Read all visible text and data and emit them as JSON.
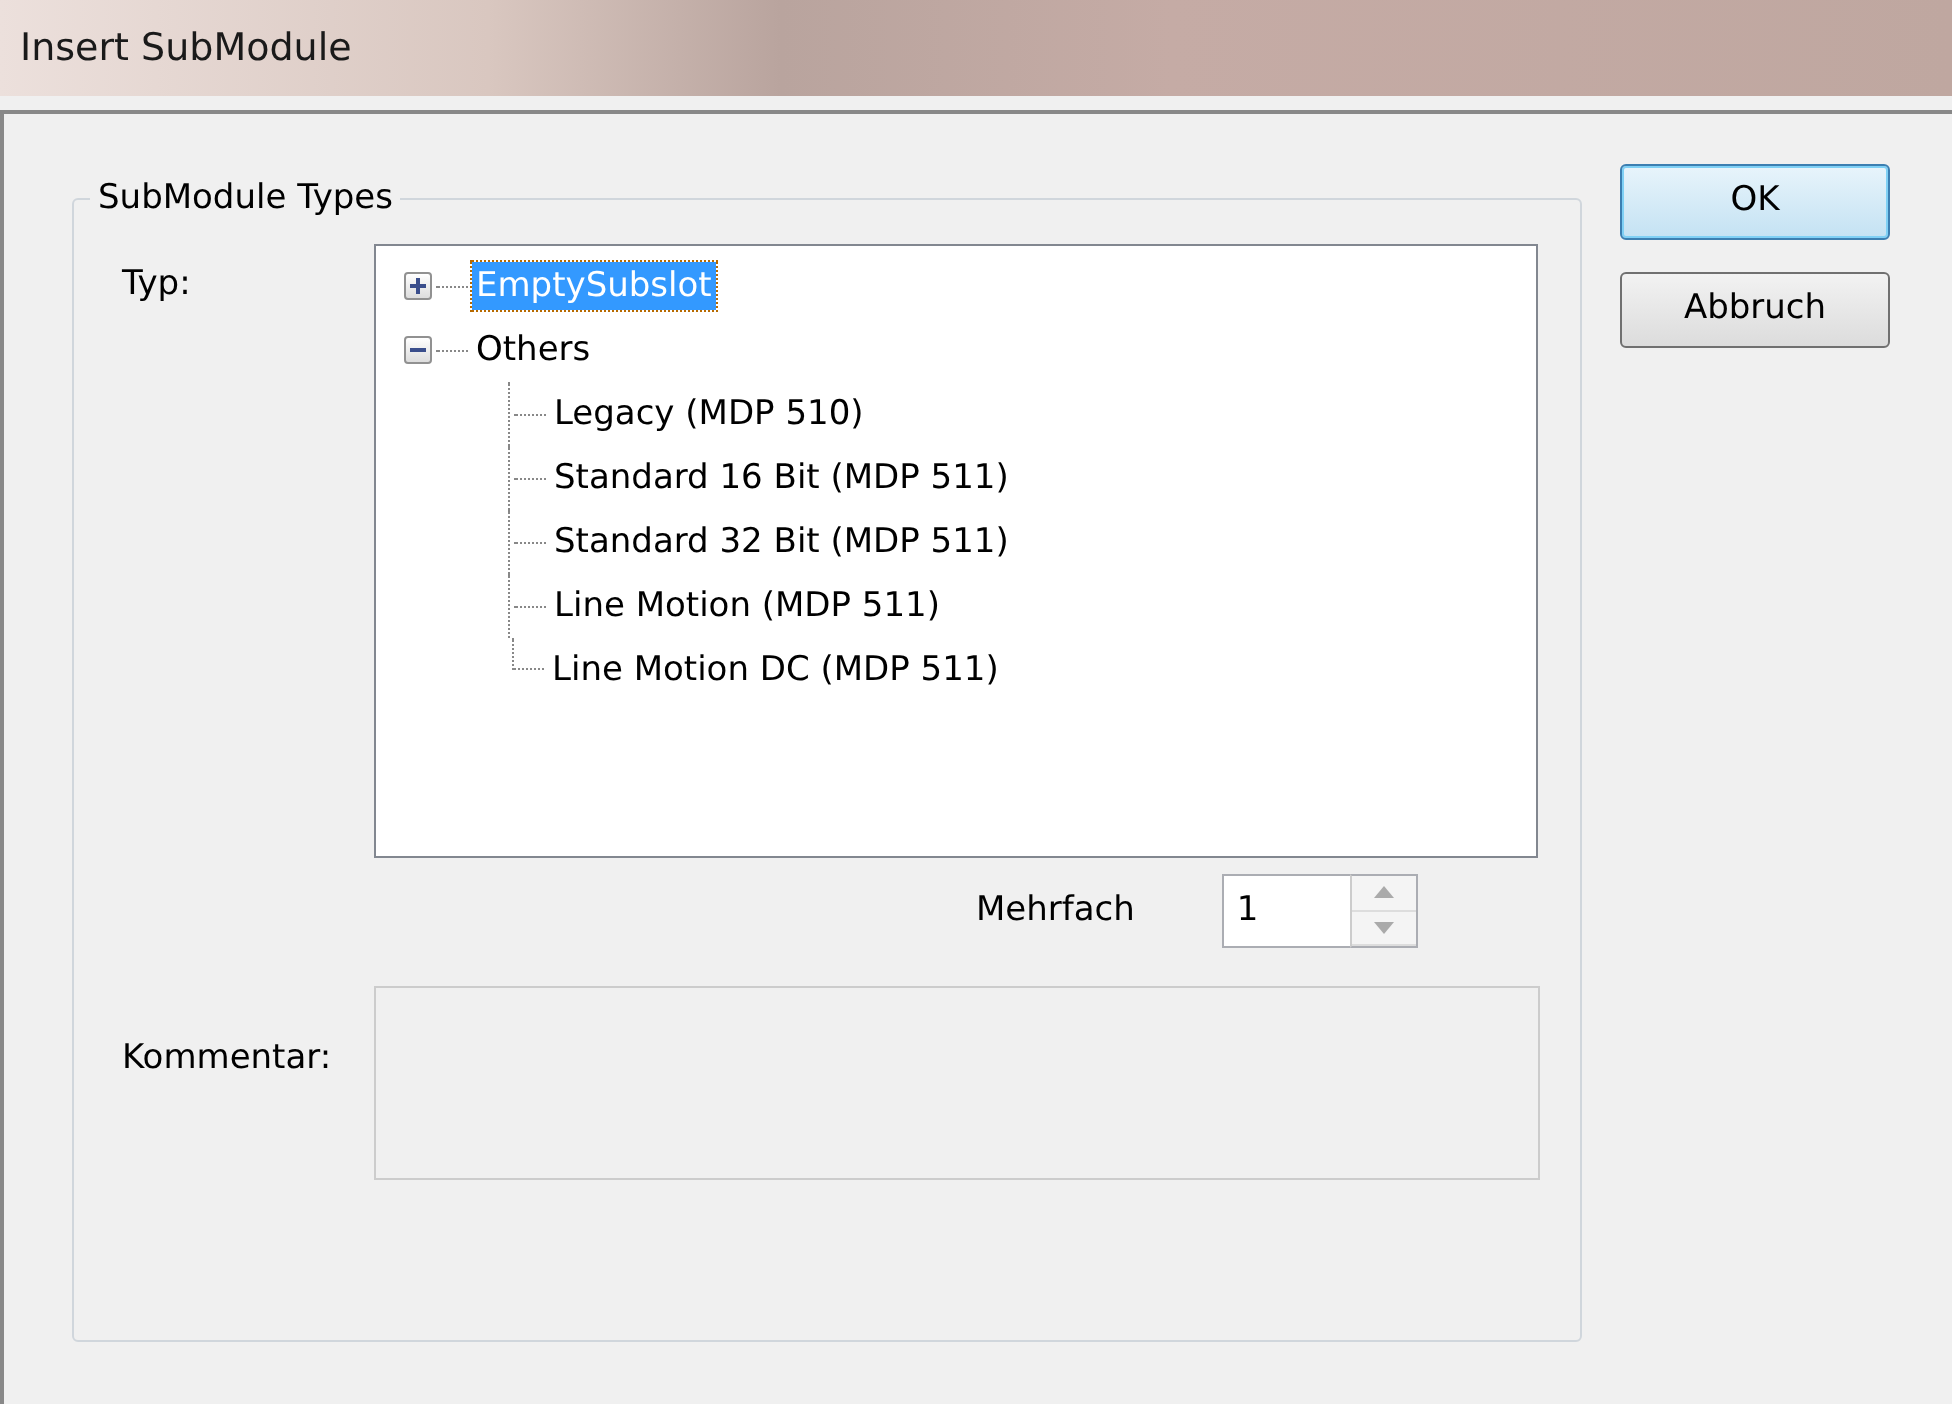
{
  "window": {
    "title": "Insert SubModule"
  },
  "group": {
    "title": "SubModule Types"
  },
  "type_label": "Typ:",
  "tree": [
    {
      "label": "EmptySubslot",
      "expanded": false,
      "selected": true
    },
    {
      "label": "Others",
      "expanded": true,
      "selected": false,
      "children": [
        {
          "label": "Legacy (MDP 510)",
          "selected": false
        },
        {
          "label": "Standard 16 Bit (MDP 511)",
          "selected": false
        },
        {
          "label": "Standard 32 Bit (MDP 511)",
          "selected": false
        },
        {
          "label": "Line Motion (MDP 511)",
          "selected": false
        },
        {
          "label": "Line Motion DC (MDP 511)",
          "selected": false
        }
      ]
    }
  ],
  "multiple": {
    "label": "Mehrfach",
    "value": "1"
  },
  "comment": {
    "label": "Kommentar:"
  },
  "buttons": [
    {
      "label": "OK",
      "default": true
    },
    {
      "label": "Abbruch",
      "default": false
    }
  ]
}
